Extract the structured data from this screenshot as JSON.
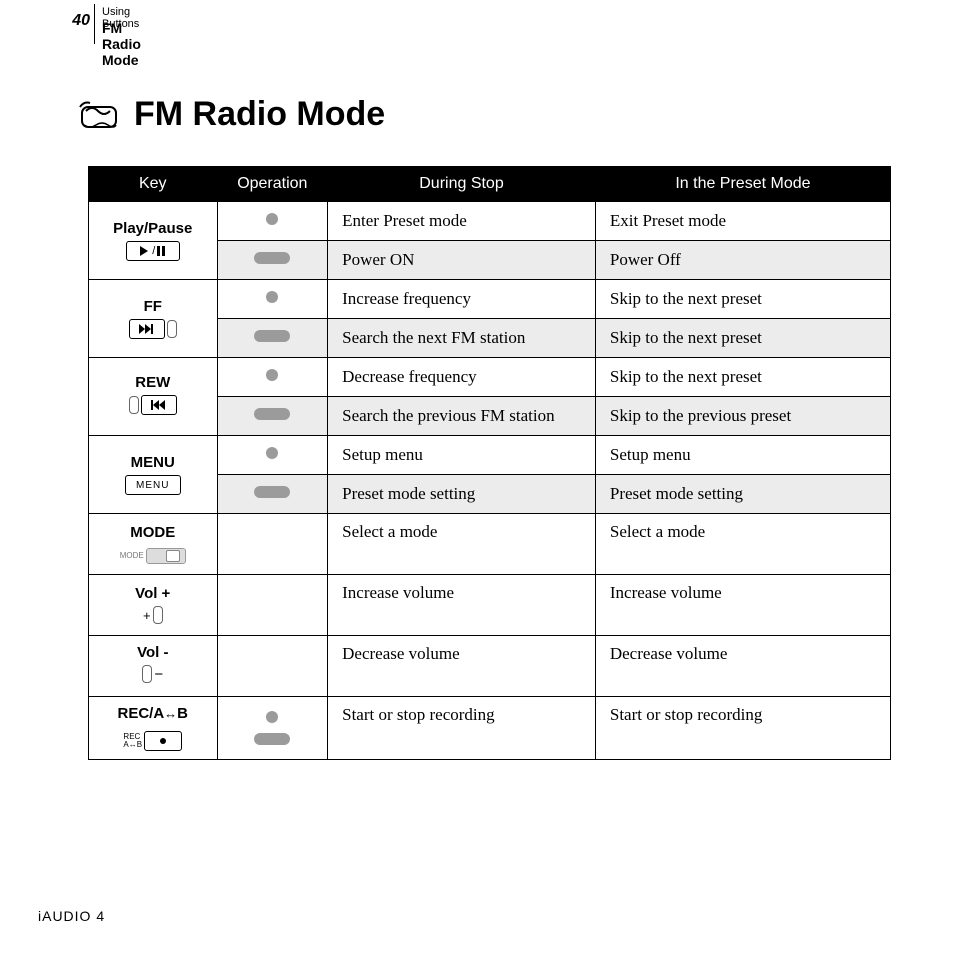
{
  "page_number": "40",
  "breadcrumb": "Using Buttons",
  "section": "FM Radio Mode",
  "title": "FM Radio Mode",
  "footer": "iAUDIO 4",
  "headers": {
    "c1": "Key",
    "c2": "Operation",
    "c3": "During Stop",
    "c4": "In the Preset Mode"
  },
  "rows": [
    {
      "key": "Play/Pause",
      "icon": "playpause",
      "r1": {
        "op": "dot",
        "stop": "Enter Preset mode",
        "preset": "Exit Preset mode",
        "shade": false
      },
      "r2": {
        "op": "pill",
        "stop": "Power ON",
        "preset": "Power Off",
        "shade": true
      }
    },
    {
      "key": "FF",
      "icon": "ff",
      "r1": {
        "op": "dot",
        "stop": "Increase frequency",
        "preset": "Skip to the next preset",
        "shade": false
      },
      "r2": {
        "op": "pill",
        "stop": "Search the next FM station",
        "preset": "Skip to the next preset",
        "shade": true
      }
    },
    {
      "key": "REW",
      "icon": "rew",
      "r1": {
        "op": "dot",
        "stop": "Decrease frequency",
        "preset": "Skip to the next preset",
        "shade": false
      },
      "r2": {
        "op": "pill",
        "stop": "Search the previous FM station",
        "preset": "Skip to the previous preset",
        "shade": true
      }
    },
    {
      "key": "MENU",
      "icon": "menu",
      "r1": {
        "op": "dot",
        "stop": "Setup menu",
        "preset": "Setup menu",
        "shade": false
      },
      "r2": {
        "op": "pill",
        "stop": "Preset mode setting",
        "preset": "Preset mode setting",
        "shade": true
      }
    }
  ],
  "singles": [
    {
      "key": "MODE",
      "icon": "mode",
      "stop": "Select a mode",
      "preset": "Select a mode"
    },
    {
      "key": "Vol +",
      "icon": "volup",
      "stop": "Increase volume",
      "preset": "Increase volume"
    },
    {
      "key": "Vol -",
      "icon": "voldown",
      "stop": "Decrease volume",
      "preset": "Decrease volume"
    }
  ],
  "rec": {
    "key": "REC/A↔B",
    "icon": "rec",
    "stop": "Start or stop recording",
    "preset": "Start or stop recording"
  }
}
